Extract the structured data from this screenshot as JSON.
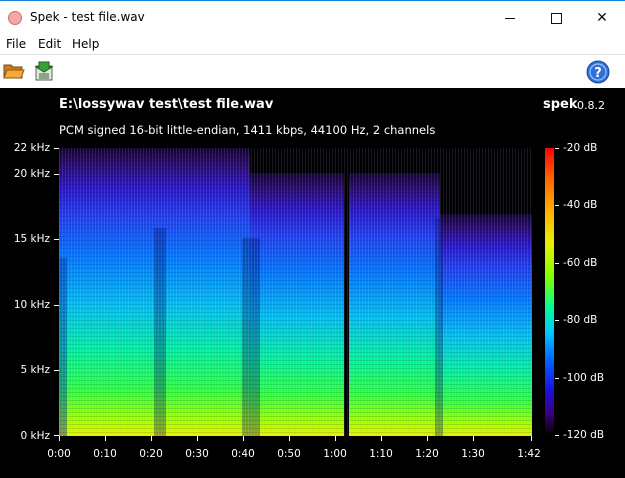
{
  "window": {
    "title": "Spek - test file.wav",
    "minimize": "minimize",
    "maximize": "maximize",
    "close": "✕"
  },
  "menu": {
    "file": "File",
    "edit": "Edit",
    "help": "Help"
  },
  "toolbar": {
    "open_icon": "folder-open-icon",
    "save_icon": "save-icon",
    "help_icon": "help-icon"
  },
  "spek": {
    "file_path": "E:\\lossywav test\\test file.wav",
    "brand": "spek",
    "version": "0.8.2",
    "file_info": "PCM signed 16-bit little-endian, 1411 kbps, 44100 Hz, 2 channels"
  },
  "freq_labels": [
    "22 kHz",
    "20 kHz",
    "15 kHz",
    "10 kHz",
    "5 kHz",
    "0 kHz"
  ],
  "time_labels": [
    "0:00",
    "0:10",
    "0:20",
    "0:30",
    "0:40",
    "0:50",
    "1:00",
    "1:10",
    "1:20",
    "1:30",
    "1:42"
  ],
  "db_labels": [
    "-20 dB",
    "-40 dB",
    "-60 dB",
    "-80 dB",
    "-100 dB",
    "-120 dB"
  ],
  "colors": {
    "background": "#000000",
    "titlebar_border": "#1883d7"
  }
}
